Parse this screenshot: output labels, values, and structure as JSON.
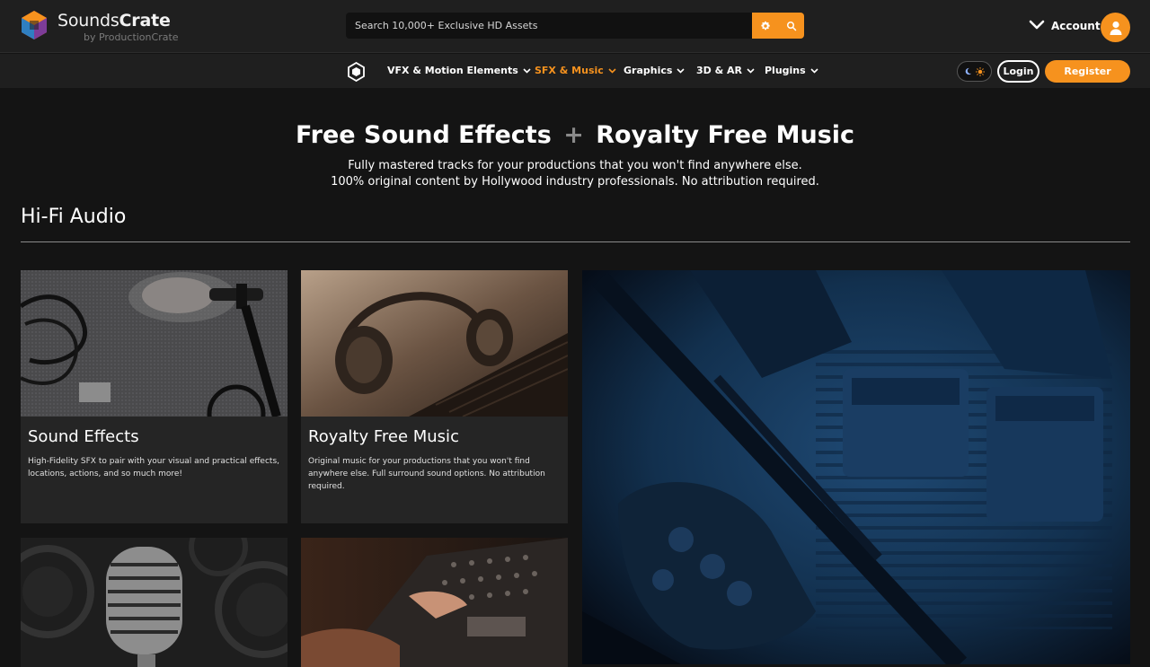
{
  "brand": {
    "name_light": "Sounds",
    "name_bold": "Crate",
    "sub": "by ProductionCrate",
    "accent": "#f6921e"
  },
  "search": {
    "placeholder": "Search 10,000+ Exclusive HD Assets",
    "gear_icon": "gear-icon",
    "search_icon": "search-icon"
  },
  "account": {
    "label": "Account"
  },
  "nav": {
    "items": [
      {
        "label": "VFX & Motion Elements",
        "active": false
      },
      {
        "label": "SFX & Music",
        "active": true
      },
      {
        "label": "Graphics",
        "active": false
      },
      {
        "label": "3D & AR",
        "active": false
      },
      {
        "label": "Plugins",
        "active": false
      }
    ],
    "login": "Login",
    "register": "Register"
  },
  "hero": {
    "title_left": "Free Sound Effects",
    "title_plus": "+",
    "title_right": "Royalty Free Music",
    "line1": "Fully mastered tracks for your productions that you won't find anywhere else.",
    "line2": "100% original content by Hollywood industry professionals. No attribution required."
  },
  "section": {
    "title": "Hi-Fi Audio"
  },
  "cards": [
    {
      "title": "Sound Effects",
      "description": "High-Fidelity SFX to pair with your visual and practical effects, locations, actions, and so much more!"
    },
    {
      "title": "Royalty Free Music",
      "description": "Original music for your productions that you won't find anywhere else. Full surround sound options. No attribution required."
    }
  ]
}
